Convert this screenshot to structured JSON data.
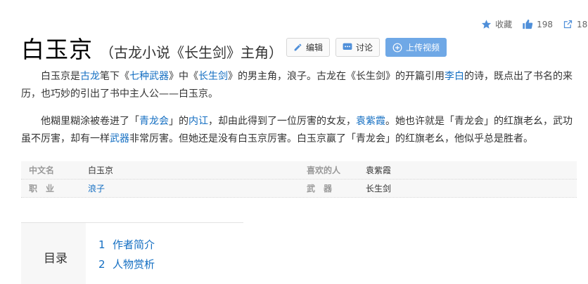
{
  "topbar": {
    "favorite_label": "收藏",
    "like_count": "198",
    "share_count": "18"
  },
  "title": {
    "main": "白玉京",
    "sub": "（古龙小说《长生剑》主角）"
  },
  "buttons": {
    "edit": "编辑",
    "discuss": "讨论",
    "upload_video": "上传视频"
  },
  "intro": {
    "p1": [
      {
        "t": "白玉京是",
        "link": false
      },
      {
        "t": "古龙",
        "link": true
      },
      {
        "t": "笔下《",
        "link": false
      },
      {
        "t": "七种武器",
        "link": true
      },
      {
        "t": "》中《",
        "link": false
      },
      {
        "t": "长生剑",
        "link": true
      },
      {
        "t": "》的男主角，浪子。古龙在《长生剑》的开篇引用",
        "link": false
      },
      {
        "t": "李白",
        "link": true
      },
      {
        "t": "的诗，既点出了书名的来历，也巧妙的引出了书中主人公——白玉京。",
        "link": false
      }
    ],
    "p2": [
      {
        "t": "他糊里糊涂被卷进了「",
        "link": false
      },
      {
        "t": "青龙会",
        "link": true
      },
      {
        "t": "」的",
        "link": false
      },
      {
        "t": "内讧",
        "link": true
      },
      {
        "t": "，却由此得到了一位厉害的女友，",
        "link": false
      },
      {
        "t": "袁紫霞",
        "link": true
      },
      {
        "t": "。她也许就是「青龙会」的红旗老幺，武功虽不厉害，却有一样",
        "link": false
      },
      {
        "t": "武器",
        "link": true
      },
      {
        "t": "非常厉害。但她还是没有白玉京厉害。白玉京赢了「青龙会」的红旗老幺，他似乎总是胜者。",
        "link": false
      }
    ]
  },
  "basic_info": {
    "rows": [
      [
        {
          "label": "中文名",
          "value": "白玉京",
          "link": false
        },
        {
          "label": "喜欢的人",
          "value": "袁紫霞",
          "link": false
        }
      ],
      [
        {
          "label": "职　业",
          "value": "浪子",
          "link": true
        },
        {
          "label": "武　器",
          "value": "长生剑",
          "link": false
        }
      ]
    ]
  },
  "toc": {
    "title": "目录",
    "items": [
      {
        "num": "1",
        "label": "作者简介"
      },
      {
        "num": "2",
        "label": "人物赏析"
      }
    ]
  },
  "colors": {
    "link": "#136ec2",
    "primary_button": "#6fa8e6",
    "icon_blue": "#4f8fd9"
  }
}
